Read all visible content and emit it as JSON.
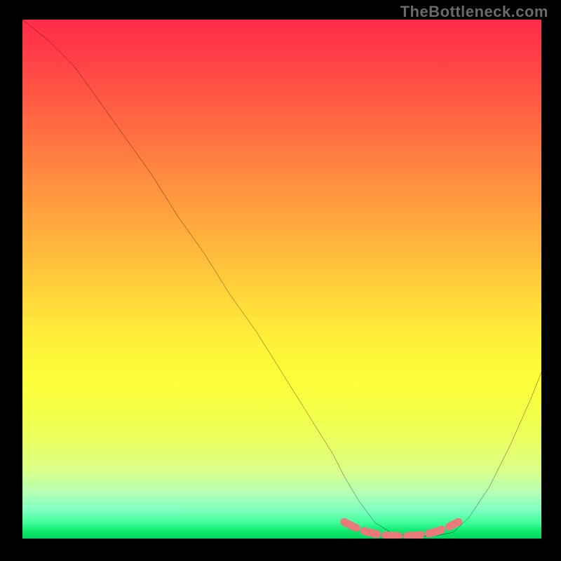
{
  "watermark": "TheBottleneck.com",
  "chart_data": {
    "type": "line",
    "title": "",
    "xlabel": "",
    "ylabel": "",
    "xlim": [
      0,
      100
    ],
    "ylim": [
      0,
      100
    ],
    "series": [
      {
        "name": "bottleneck-curve",
        "color": "#000000",
        "x": [
          0,
          5,
          10,
          15,
          20,
          25,
          30,
          35,
          40,
          45,
          50,
          55,
          60,
          62,
          65,
          68,
          71,
          74,
          77,
          80,
          83,
          86,
          90,
          94,
          98,
          100
        ],
        "y": [
          100,
          96,
          91,
          84,
          77,
          70,
          62,
          55,
          47,
          40,
          32,
          24,
          16,
          12,
          7,
          3,
          1.2,
          0.6,
          0.4,
          0.6,
          1.2,
          4,
          10,
          18,
          27,
          32
        ]
      },
      {
        "name": "optimal-zone-marker",
        "color": "#e97a7a",
        "x": [
          62,
          64,
          66,
          68,
          70,
          72,
          74,
          76,
          78,
          80,
          82,
          84
        ],
        "y": [
          3.2,
          2.2,
          1.4,
          0.9,
          0.6,
          0.5,
          0.5,
          0.6,
          0.9,
          1.4,
          2.2,
          3.2
        ]
      }
    ],
    "gradient": {
      "stops": [
        {
          "pos": 0.0,
          "color": "#ff2b4a"
        },
        {
          "pos": 0.3,
          "color": "#ff8a40"
        },
        {
          "pos": 0.62,
          "color": "#fff038"
        },
        {
          "pos": 0.87,
          "color": "#d8ff8a"
        },
        {
          "pos": 1.0,
          "color": "#00d860"
        }
      ]
    }
  }
}
